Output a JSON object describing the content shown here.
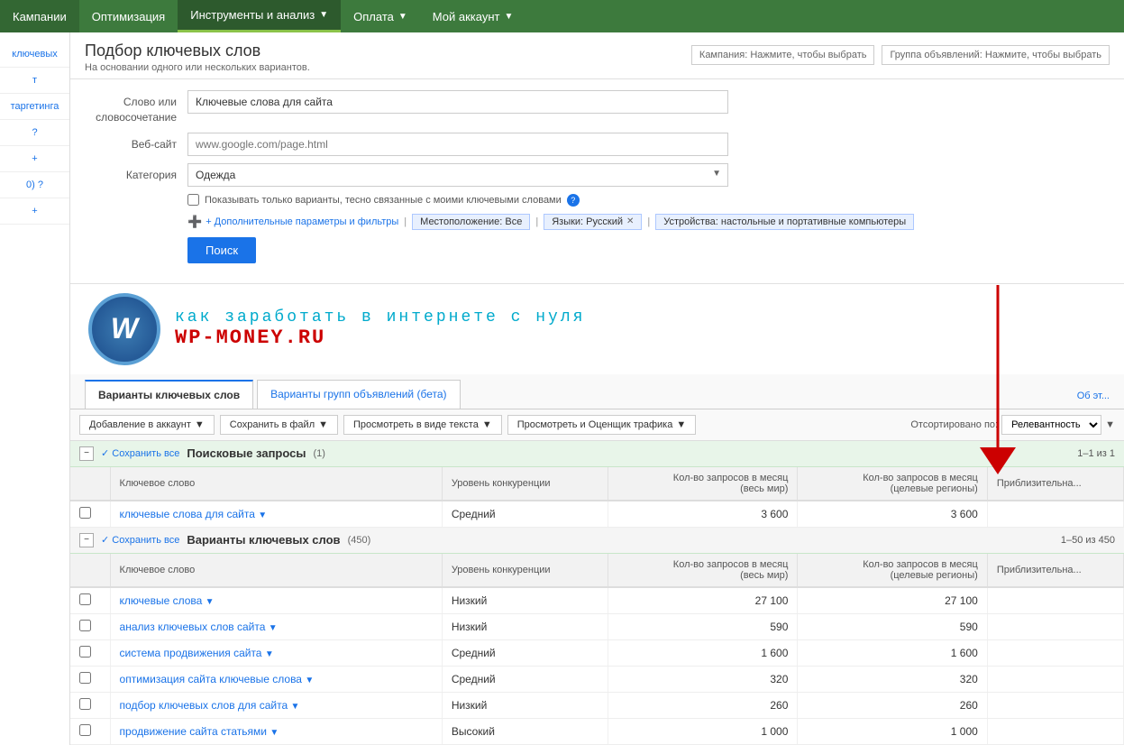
{
  "nav": {
    "items": [
      {
        "label": "Кампании",
        "active": false
      },
      {
        "label": "Оптимизация",
        "active": false
      },
      {
        "label": "Инструменты и анализ",
        "active": true,
        "hasArrow": true
      },
      {
        "label": "Оплата",
        "active": false,
        "hasArrow": true
      },
      {
        "label": "Мой аккаунт",
        "active": false,
        "hasArrow": true
      }
    ]
  },
  "sidebar": {
    "items": [
      {
        "label": "ключевых"
      },
      {
        "label": "т"
      },
      {
        "label": "таргетинга"
      },
      {
        "label": "?"
      },
      {
        "label": "+"
      },
      {
        "label": "0) ?"
      },
      {
        "label": "+"
      }
    ]
  },
  "header": {
    "title": "Подбор ключевых слов",
    "subtitle": "На основании одного или нескольких вариантов.",
    "campaign_label": "Кампания: Нажмите, чтобы выбрать",
    "adgroup_label": "Группа объявлений: Нажмите, чтобы выбрать"
  },
  "form": {
    "word_label": "Слово или\nсловосочетание",
    "word_value": "Ключевые слова для сайта",
    "website_label": "Веб-сайт",
    "website_placeholder": "www.google.com/page.html",
    "category_label": "Категория",
    "category_value": "Одежда",
    "checkbox_label": "Показывать только варианты, тесно связанные с моими ключевыми словами",
    "filter_link": "+ Дополнительные параметры и фильтры",
    "location_tag": "Местоположение: Все",
    "language_tag": "Языки: Русский",
    "device_tag": "Устройства: настольные и портативные компьютеры",
    "search_btn": "Поиск"
  },
  "watermark": {
    "line1": "как заработать в интернете с нуля",
    "line2": "WP-MONEY.RU",
    "logo": "W"
  },
  "tabs": {
    "items": [
      {
        "label": "Варианты ключевых слов",
        "active": true
      },
      {
        "label": "Варианты групп объявлений (бета)",
        "active": false
      }
    ],
    "link": "Об эт..."
  },
  "toolbar": {
    "add_btn": "Добавление в аккаунт",
    "save_btn": "Сохранить в файл",
    "view_text_btn": "Просмотреть в виде текста",
    "view_traffic_btn": "Просмотреть и Оценщик трафика",
    "sort_label": "Отсортировано по:",
    "sort_value": "Релевантность"
  },
  "section1": {
    "title": "Поисковые запросы",
    "count": "(1)",
    "save_all": "✓ Сохранить все",
    "pagination": "1–1 из 1",
    "columns": [
      {
        "label": "Ключевое слово"
      },
      {
        "label": "Уровень конкуренции"
      },
      {
        "label": "Кол-во запросов в месяц\n(весь мир)"
      },
      {
        "label": "Кол-во запросов в месяц\n(целевые регионы)"
      },
      {
        "label": "Приблизительна..."
      }
    ],
    "rows": [
      {
        "keyword": "ключевые слова для сайта",
        "competition": "Средний",
        "global": "3 600",
        "local": "3 600",
        "cpc": ""
      }
    ]
  },
  "section2": {
    "title": "Варианты ключевых слов",
    "count": "(450)",
    "save_all": "✓ Сохранить все",
    "pagination": "1–50 из 450",
    "columns": [
      {
        "label": "Ключевое слово"
      },
      {
        "label": "Уровень конкуренции"
      },
      {
        "label": "Кол-во запросов в месяц\n(весь мир)"
      },
      {
        "label": "Кол-во запросов в месяц\n(целевые регионы)"
      },
      {
        "label": "Приблизительна..."
      }
    ],
    "rows": [
      {
        "keyword": "ключевые слова",
        "competition": "Низкий",
        "global": "27 100",
        "local": "27 100",
        "cpc": ""
      },
      {
        "keyword": "анализ ключевых слов сайта",
        "competition": "Низкий",
        "global": "590",
        "local": "590",
        "cpc": ""
      },
      {
        "keyword": "система продвижения сайта",
        "competition": "Средний",
        "global": "1 600",
        "local": "1 600",
        "cpc": ""
      },
      {
        "keyword": "оптимизация сайта ключевые слова",
        "competition": "Средний",
        "global": "320",
        "local": "320",
        "cpc": ""
      },
      {
        "keyword": "подбор ключевых слов для сайта",
        "competition": "Низкий",
        "global": "260",
        "local": "260",
        "cpc": ""
      },
      {
        "keyword": "продвижение сайта статьями",
        "competition": "Высокий",
        "global": "1 000",
        "local": "1 000",
        "cpc": ""
      }
    ]
  }
}
